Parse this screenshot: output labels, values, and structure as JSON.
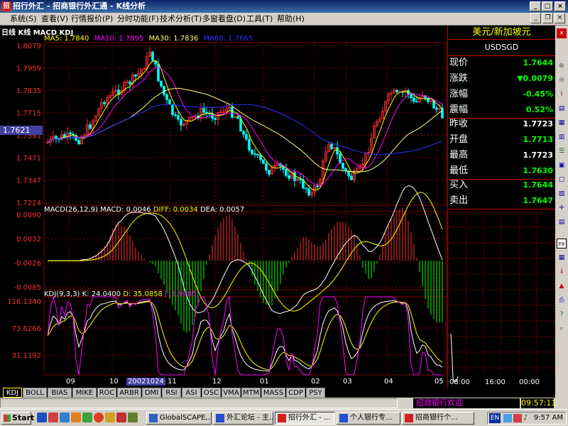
{
  "window": {
    "title": "招行外汇 - 招商银行外汇通 - K线分析",
    "app_icon_text": "招"
  },
  "menu": [
    "系统(S)",
    "查看(V)",
    "行情报价(P)",
    "分时功能(F)",
    "技术分析(T)",
    "多窗看盘(D)",
    "工具(T)",
    "帮助(H)"
  ],
  "chart": {
    "period_label": "日线 K线 MACD KDJ",
    "ma": {
      "ma5": "MA5: 1.7840",
      "ma10": "MA10: 1.7895",
      "ma30": "MA30: 1.7836",
      "ma60": "MA60: 1.7665",
      "colors": {
        "ma5": "#ffff00",
        "ma10": "#ff00ff",
        "ma30": "#ffff80",
        "ma60": "#3030ff"
      }
    },
    "price_ticks": [
      "1.8079",
      "1.7959",
      "1.7835",
      "1.7715",
      "1.7591",
      "1.7471",
      "1.7347",
      "1.7224"
    ],
    "current_price": "1.7621",
    "macd": {
      "header": "MACD(26,12,9)",
      "macd": "MACD: 0.0046",
      "diff": "DIFF: 0.0034",
      "dea": "DEA: 0.0057",
      "ticks": [
        "0.0090",
        "0.0032",
        "-0.0026",
        "-0.0085"
      ]
    },
    "kdj": {
      "header": "KDJ(9,3,3)",
      "k": "K: 24.0400",
      "d": "D: 35.0858",
      "j": "J: 1.9485",
      "ticks": [
        "116.1340",
        "73.6266",
        "31.1192"
      ]
    },
    "x_labels": [
      "09",
      "10",
      "11",
      "12",
      "01",
      "02",
      "03",
      "04",
      "05"
    ],
    "cursor_date": "20021024",
    "colors": {
      "up": "#ff3030",
      "down": "#00ffff",
      "grid": "#800000",
      "k": "#ffffff",
      "d": "#ffff00",
      "j": "#ff00ff"
    }
  },
  "info": {
    "pair_name": "美元/新加坡元",
    "pair_code": "USDSGD",
    "rows": [
      {
        "label": "现价",
        "value": "1.7644",
        "color": "green"
      },
      {
        "label": "涨跌",
        "value": "▼0.0079",
        "color": "green"
      },
      {
        "label": "涨幅",
        "value": "-0.45%",
        "color": "green"
      },
      {
        "label": "震幅",
        "value": "0.52%",
        "color": "green"
      },
      {
        "label": "昨收",
        "value": "1.7723",
        "color": "white"
      },
      {
        "label": "开盘",
        "value": "1.7713",
        "color": "green"
      },
      {
        "label": "最高",
        "value": "1.7723",
        "color": "white"
      },
      {
        "label": "最低",
        "value": "1.7630",
        "color": "green"
      },
      {
        "label": "买入",
        "value": "1.7644",
        "color": "green"
      },
      {
        "label": "卖出",
        "value": "1.7647",
        "color": "green"
      }
    ],
    "minute_times": [
      "08:00",
      "16:00",
      "00:00"
    ]
  },
  "tabs": [
    "KDJ",
    "BOLL",
    "BIAS",
    "MIKE",
    "ROC",
    "ARBR",
    "DMI",
    "RSI",
    "ASI",
    "OSC",
    "VMA",
    "MTM",
    "MASS",
    "CDP",
    "PSY"
  ],
  "status": {
    "marquee": "招商银行欢迎",
    "clock": "09:57:11"
  },
  "taskbar": {
    "start": "Start",
    "buttons": [
      "GlobalSCAPE,...",
      "外汇论坛 - 主...",
      "招行外汇 - ...",
      "个人银行专...",
      "招商银行个..."
    ],
    "tray_lang": "EN",
    "tray_time": "9:57 AM"
  }
}
